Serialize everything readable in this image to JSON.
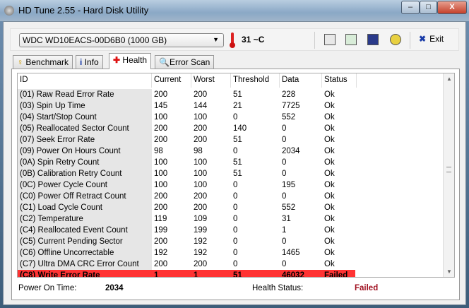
{
  "window": {
    "title": "HD Tune 2.55 - Hard Disk Utility",
    "minimize": "–",
    "maximize": "□",
    "close": "X"
  },
  "toolbar": {
    "drive": "WDC WD10EACS-00D6B0 (1000 GB)",
    "temperature": "31 ~C",
    "exit_label": "Exit",
    "exit_icon": "x-icon"
  },
  "tabs": [
    {
      "label": "Benchmark"
    },
    {
      "label": "Info"
    },
    {
      "label": "Health"
    },
    {
      "label": "Error Scan"
    }
  ],
  "table": {
    "columns": [
      "ID",
      "Current",
      "Worst",
      "Threshold",
      "Data",
      "Status"
    ],
    "rows": [
      [
        "(01) Raw Read Error Rate",
        "200",
        "200",
        "51",
        "228",
        "Ok"
      ],
      [
        "(03) Spin Up Time",
        "145",
        "144",
        "21",
        "7725",
        "Ok"
      ],
      [
        "(04) Start/Stop Count",
        "100",
        "100",
        "0",
        "552",
        "Ok"
      ],
      [
        "(05) Reallocated Sector Count",
        "200",
        "200",
        "140",
        "0",
        "Ok"
      ],
      [
        "(07) Seek Error Rate",
        "200",
        "200",
        "51",
        "0",
        "Ok"
      ],
      [
        "(09) Power On Hours Count",
        "98",
        "98",
        "0",
        "2034",
        "Ok"
      ],
      [
        "(0A) Spin Retry Count",
        "100",
        "100",
        "51",
        "0",
        "Ok"
      ],
      [
        "(0B) Calibration Retry Count",
        "100",
        "100",
        "51",
        "0",
        "Ok"
      ],
      [
        "(0C) Power Cycle Count",
        "100",
        "100",
        "0",
        "195",
        "Ok"
      ],
      [
        "(C0) Power Off Retract Count",
        "200",
        "200",
        "0",
        "0",
        "Ok"
      ],
      [
        "(C1) Load Cycle Count",
        "200",
        "200",
        "0",
        "552",
        "Ok"
      ],
      [
        "(C2) Temperature",
        "119",
        "109",
        "0",
        "31",
        "Ok"
      ],
      [
        "(C4) Reallocated Event Count",
        "199",
        "199",
        "0",
        "1",
        "Ok"
      ],
      [
        "(C5) Current Pending Sector",
        "200",
        "192",
        "0",
        "0",
        "Ok"
      ],
      [
        "(C6) Offline Uncorrectable",
        "192",
        "192",
        "0",
        "1465",
        "Ok"
      ],
      [
        "(C7) Ultra DMA CRC Error Count",
        "200",
        "200",
        "0",
        "0",
        "Ok"
      ],
      [
        "(C8) Write Error Rate",
        "1",
        "1",
        "51",
        "46032",
        "Failed"
      ]
    ]
  },
  "footer": {
    "power_on_label": "Power On Time:",
    "power_on_value": "2034",
    "health_label": "Health Status:",
    "health_value": "Failed"
  },
  "colors": {
    "failed_row": "#ff3333",
    "failed_text": "#a01020"
  }
}
